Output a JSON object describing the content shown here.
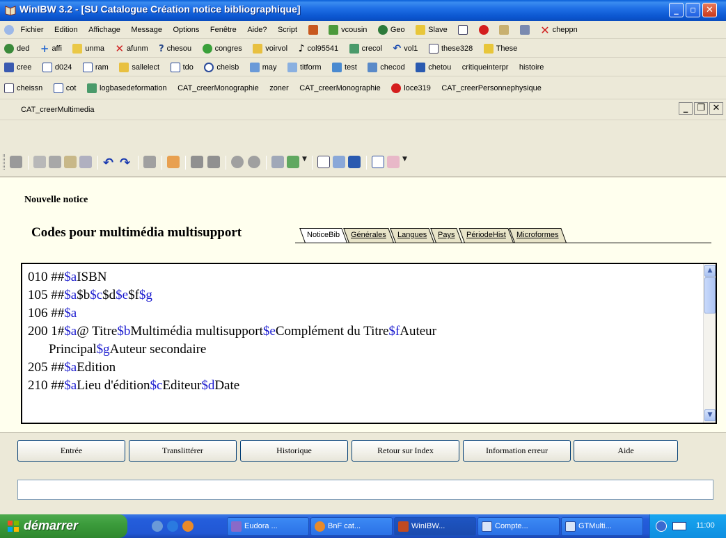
{
  "window": {
    "title": "WinIBW 3.2 - [SU Catalogue Création notice bibliographique]"
  },
  "menubar": {
    "items": [
      "Fichier",
      "Edition",
      "Affichage",
      "Message",
      "Options",
      "Fenêtre",
      "Aide?",
      "Script"
    ],
    "scripts": [
      "vcousin",
      "Geo",
      "Slave",
      "cheppn"
    ]
  },
  "row2": [
    "ded",
    "affi",
    "unma",
    "afunm",
    "chesou",
    "congres",
    "voirvol",
    "col95541",
    "crecol",
    "vol1",
    "these328",
    "These"
  ],
  "row3": [
    "cree",
    "d024",
    "ram",
    "sallelect",
    "tdo",
    "cheisb",
    "may",
    "titform",
    "test",
    "checod",
    "chetou",
    "critiqueinterpr",
    "histoire"
  ],
  "row4": [
    "cheissn",
    "cot",
    "logbasedeformation",
    "CAT_creerMonographie",
    "zoner",
    "CAT_creerMonographie",
    "loce319",
    "CAT_creerPersonnephysique"
  ],
  "row5": [
    "CAT_creerMultimedia"
  ],
  "main": {
    "heading": "Nouvelle notice",
    "form_title": "Codes pour multimédia multisupport",
    "tabs": [
      "NoticeBib",
      "Générales",
      "Langues",
      "Pays",
      "PériodeHist",
      "Microformes"
    ]
  },
  "record": {
    "l010": {
      "tag": "010 ##",
      "s1": "$a",
      "t1": "ISBN"
    },
    "l105": {
      "tag": "105 ##",
      "s1": "$a",
      "t1": "$b",
      "s2": "$c",
      "t2": "$d",
      "s3": "$e",
      "t3": "$f",
      "s4": "$g"
    },
    "l106": {
      "tag": "106 ##",
      "s1": "$a"
    },
    "l200": {
      "tag": "200 1#",
      "s1": "$a",
      "t1": "@ Titre",
      "s2": "$b",
      "t2": "Multimédia multisupport",
      "s3": "$e",
      "t3": "Complément du Titre",
      "s4": "$f",
      "t4": "Auteur"
    },
    "l200b": {
      "t1": "Principal",
      "s1": "$g",
      "t2": "Auteur secondaire"
    },
    "l205": {
      "tag": "205 ##",
      "s1": "$a",
      "t1": "Edition"
    },
    "l210": {
      "tag": "210 ##",
      "s1": "$a",
      "t1": "Lieu d'édition",
      "s2": "$c",
      "t2": "Editeur",
      "s3": "$d",
      "t3": "Date"
    }
  },
  "buttons": [
    "Entrée",
    "Translittérer",
    "Historique",
    "Retour sur Index",
    "Information erreur",
    "Aide"
  ],
  "taskbar": {
    "start": "démarrer",
    "tasks": [
      "Eudora ...",
      "BnF cat...",
      "WinIBW...",
      "Compte...",
      "GTMulti..."
    ],
    "clock": "11:00"
  }
}
